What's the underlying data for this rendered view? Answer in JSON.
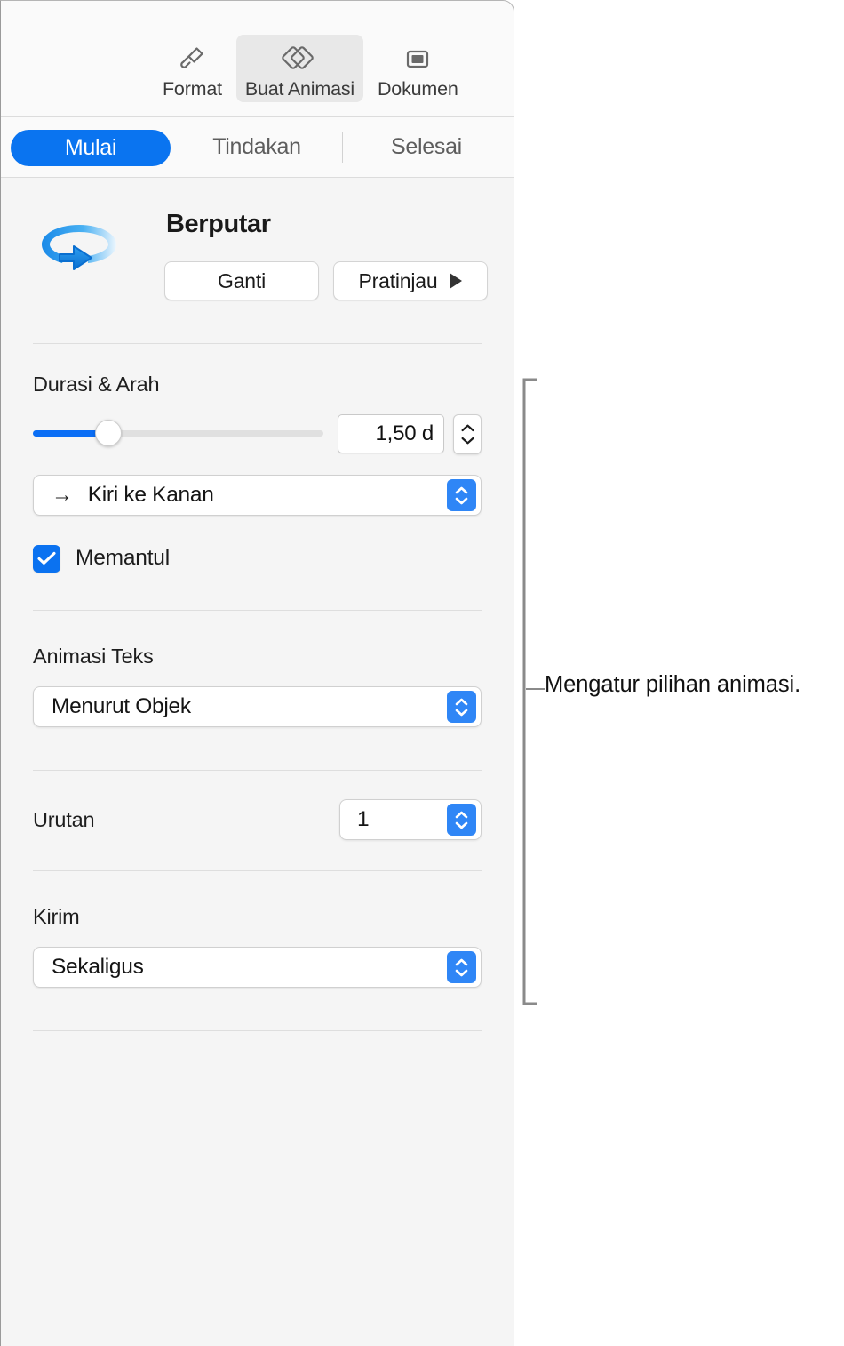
{
  "toolbar": {
    "items": [
      {
        "label": "Format",
        "icon": "paintbrush-icon",
        "active": false
      },
      {
        "label": "Buat Animasi",
        "icon": "animate-diamonds-icon",
        "active": true
      },
      {
        "label": "Dokumen",
        "icon": "document-frame-icon",
        "active": false
      }
    ]
  },
  "tabs": [
    {
      "label": "Mulai",
      "selected": true
    },
    {
      "label": "Tindakan",
      "selected": false
    },
    {
      "label": "Selesai",
      "selected": false
    }
  ],
  "effect": {
    "name": "Berputar",
    "icon": "rotate-arrow-icon",
    "change_button": "Ganti",
    "preview_button": "Pratinjau",
    "preview_icon": "play-icon"
  },
  "duration": {
    "section_label": "Durasi & Arah",
    "slider_value_percent": 24,
    "value": "1,50 d",
    "stepper_icon": "stepper-up-down-icon"
  },
  "direction": {
    "value": "Kiri ke Kanan",
    "icon": "arrow-right-icon",
    "stepper_icon": "stepper-up-down-icon"
  },
  "bounce": {
    "label": "Memantul",
    "checked": true,
    "icon": "checkmark-icon"
  },
  "text_animation": {
    "section_label": "Animasi Teks",
    "value": "Menurut Objek",
    "stepper_icon": "stepper-up-down-icon"
  },
  "order": {
    "label": "Urutan",
    "value": "1",
    "stepper_icon": "stepper-up-down-icon"
  },
  "delivery": {
    "label": "Kirim",
    "value": "Sekaligus",
    "stepper_icon": "stepper-up-down-icon"
  },
  "annotation": {
    "text": "Mengatur pilihan animasi."
  },
  "colors": {
    "accent_blue": "#0a74f0",
    "stepper_blue": "#2f86f6",
    "panel_bg": "#f5f5f5",
    "toolbar_bg": "#fafafa"
  }
}
